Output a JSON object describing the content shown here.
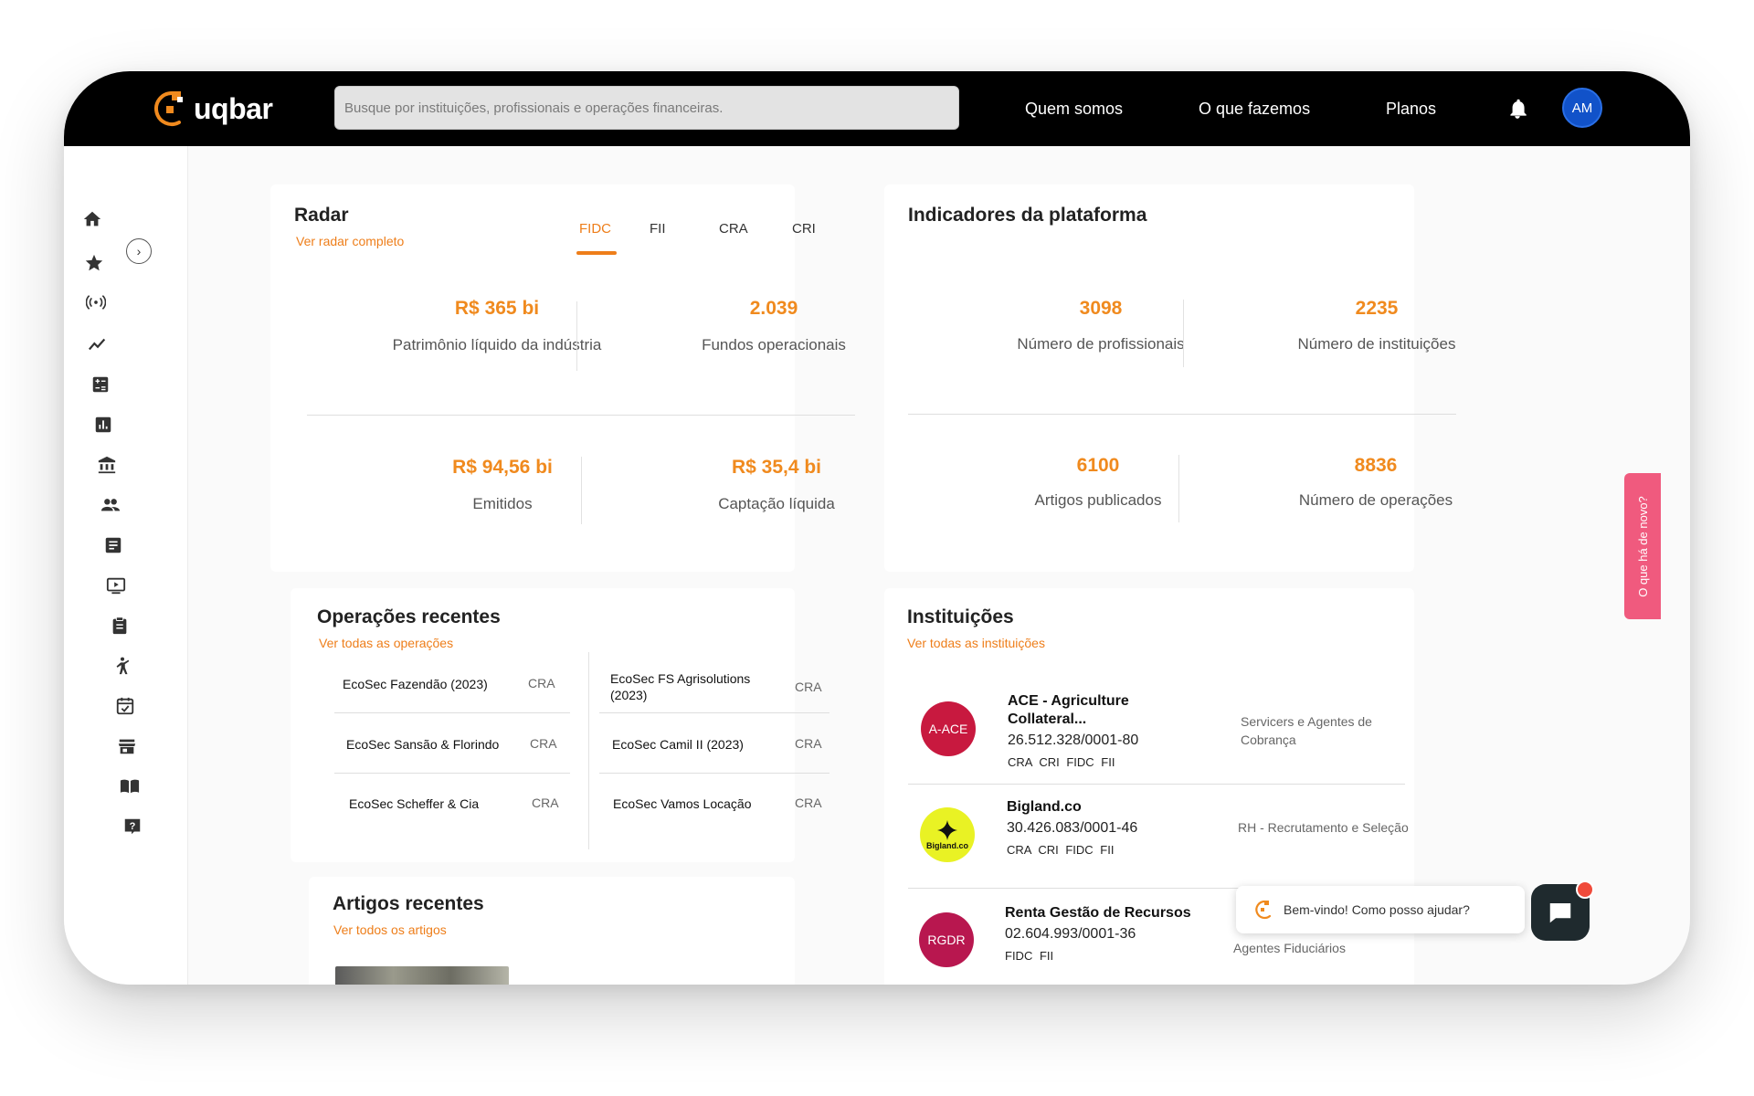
{
  "header": {
    "logo_text": "uqbar",
    "search_placeholder": "Busque por instituições, profissionais e operações financeiras.",
    "nav": [
      "Quem somos",
      "O que fazemos",
      "Planos"
    ],
    "avatar_initials": "AM"
  },
  "radar": {
    "title": "Radar",
    "link": "Ver radar completo",
    "tabs": [
      "FIDC",
      "FII",
      "CRA",
      "CRI"
    ],
    "active_tab": "FIDC",
    "stats": [
      {
        "value": "R$ 365 bi",
        "label": "Patrimônio líquido da indústria"
      },
      {
        "value": "2.039",
        "label": "Fundos operacionais"
      },
      {
        "value": "R$ 94,56 bi",
        "label": "Emitidos"
      },
      {
        "value": "R$ 35,4 bi",
        "label": "Captação líquida"
      }
    ]
  },
  "indicadores": {
    "title": "Indicadores da plataforma",
    "stats": [
      {
        "value": "3098",
        "label": "Número de profissionais"
      },
      {
        "value": "2235",
        "label": "Número de instituições"
      },
      {
        "value": "6100",
        "label": "Artigos publicados"
      },
      {
        "value": "8836",
        "label": "Número de operações"
      }
    ]
  },
  "operacoes": {
    "title": "Operações recentes",
    "link": "Ver todas as operações",
    "items": [
      {
        "name": "EcoSec Fazendão (2023)",
        "type": "CRA"
      },
      {
        "name": "EcoSec FS Agrisolutions (2023)",
        "type": "CRA"
      },
      {
        "name": "EcoSec Sansão & Florindo",
        "type": "CRA"
      },
      {
        "name": "EcoSec Camil II (2023)",
        "type": "CRA"
      },
      {
        "name": "EcoSec Scheffer & Cia",
        "type": "CRA"
      },
      {
        "name": "EcoSec Vamos Locação",
        "type": "CRA"
      }
    ]
  },
  "artigos": {
    "title": "Artigos recentes",
    "link": "Ver todos os artigos"
  },
  "instituicoes": {
    "title": "Instituições",
    "link": "Ver todas as instituições",
    "items": [
      {
        "logo": "A-ACE",
        "logo_color": "#c8193f",
        "name": "ACE - Agriculture Collateral...",
        "cnpj": "26.512.328/0001-80",
        "tags": "CRA CRI FIDC FII",
        "category": "Servicers e Agentes de Cobrança"
      },
      {
        "logo": "Bigland.co",
        "logo_color": "#e9f224",
        "name": "Bigland.co",
        "cnpj": "30.426.083/0001-46",
        "tags": "CRA CRI FIDC FII",
        "category": "RH - Recrutamento e Seleção"
      },
      {
        "logo": "RGDR",
        "logo_color": "#b8174f",
        "name": "Renta Gestão de Recursos",
        "cnpj": "02.604.993/0001-36",
        "tags": "FIDC FII",
        "category": "Agentes Fiduciários"
      }
    ]
  },
  "side_tab": "O que há de novo?",
  "chat": {
    "message": "Bem-vindo! Como posso ajudar?"
  },
  "colors": {
    "accent": "#ee7e1a",
    "topbar": "#000000",
    "avatar": "#1152c9",
    "news_tab": "#f05a7e"
  }
}
